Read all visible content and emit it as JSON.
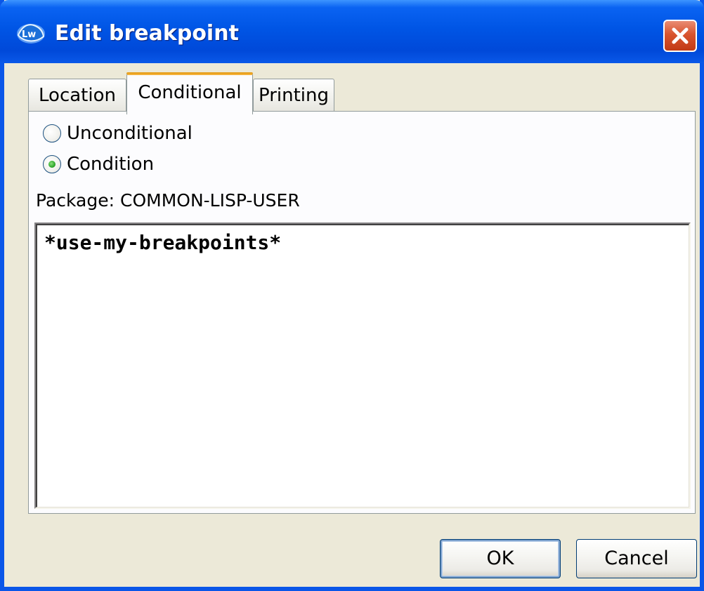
{
  "window": {
    "title": "Edit breakpoint",
    "icon": "lispworks-app-icon"
  },
  "tabs": [
    {
      "label": "Location",
      "selected": false
    },
    {
      "label": "Conditional",
      "selected": true
    },
    {
      "label": "Printing",
      "selected": false
    }
  ],
  "conditional": {
    "options": [
      {
        "label": "Unconditional",
        "checked": false
      },
      {
        "label": "Condition",
        "checked": true
      }
    ],
    "package_label": "Package: COMMON-LISP-USER",
    "condition_text": "*use-my-breakpoints*"
  },
  "buttons": {
    "ok_label": "OK",
    "cancel_label": "Cancel"
  },
  "colors": {
    "titlebar": "#0055E5",
    "dialog_bg": "#ECE9D8",
    "selected_tab_accent": "#F3B13A",
    "close_button": "#D9542E"
  }
}
